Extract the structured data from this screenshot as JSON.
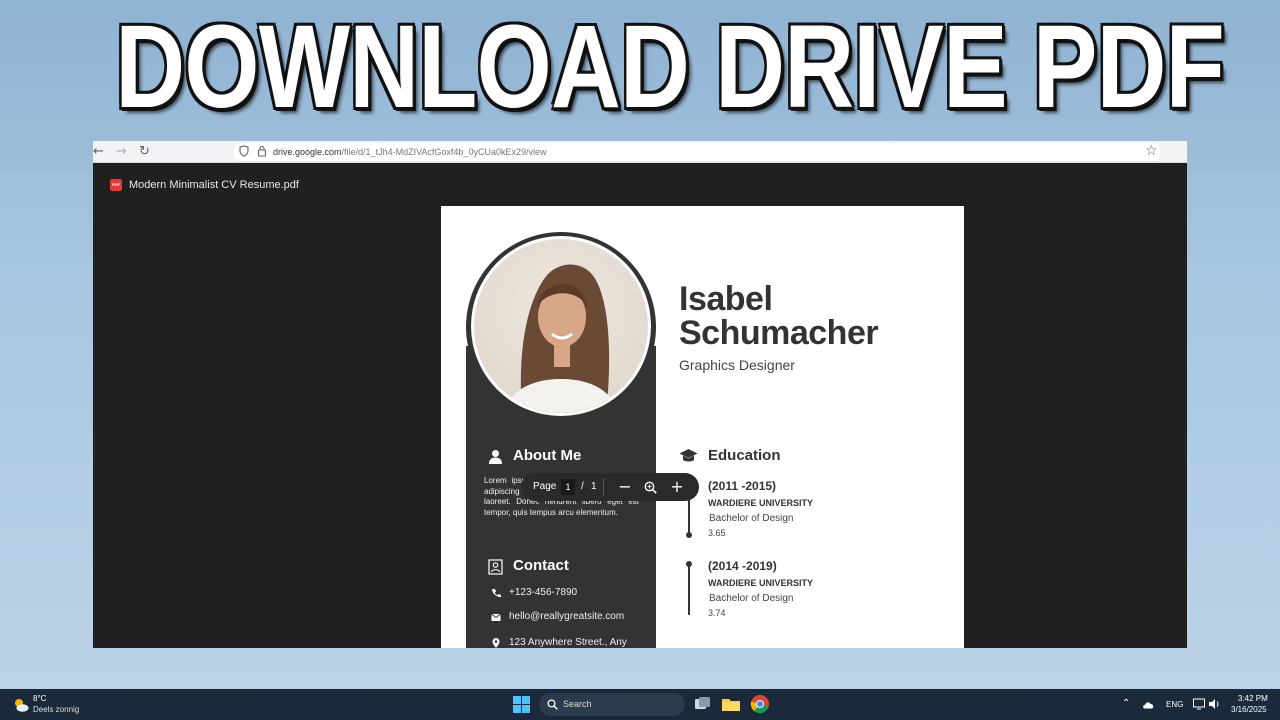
{
  "headline": "DOWNLOAD DRIVE PDF",
  "browser": {
    "url_host": "drive.google.com",
    "url_path": "/file/d/1_tJh4-MdZIVAcfGoxf4b_0yCUa0kEx29/view"
  },
  "viewer": {
    "badge": "PDF",
    "file_name": "Modern Minimalist CV Resume.pdf"
  },
  "resume": {
    "first_name": "Isabel",
    "last_name": "Schumacher",
    "role": "Graphics Designer",
    "about_title": "About Me",
    "about_text": "Lorem ipsum dolor sit amet, consectetur adipiscing elit. Nullam pharetra in lorem at laoreet. Donec hendrerit libero eget est tempor, quis tempus arcu elementum.",
    "contact_title": "Contact",
    "phone": "+123-456-7890",
    "email": "hello@reallygreatsite.com",
    "address": "123 Anywhere Street., Any",
    "education_title": "Education",
    "education": [
      {
        "years": "(2011 -2015)",
        "university": "WARDIERE UNIVERSITY",
        "degree": "Bachelor of Design",
        "gpa": "3.65"
      },
      {
        "years": "(2014 -2019)",
        "university": "WARDIERE UNIVERSITY",
        "degree": "Bachelor of Design",
        "gpa": "3.74"
      }
    ]
  },
  "page_control": {
    "label": "Page",
    "current": "1",
    "separator": "/",
    "total": "1",
    "zoom_out": "−",
    "zoom_in": "+"
  },
  "taskbar": {
    "weather_temp": "8°C",
    "weather_desc": "Deels zonnig",
    "search_label": "Search",
    "language": "ENG",
    "time": "3:42 PM",
    "date": "3/16/2025"
  }
}
